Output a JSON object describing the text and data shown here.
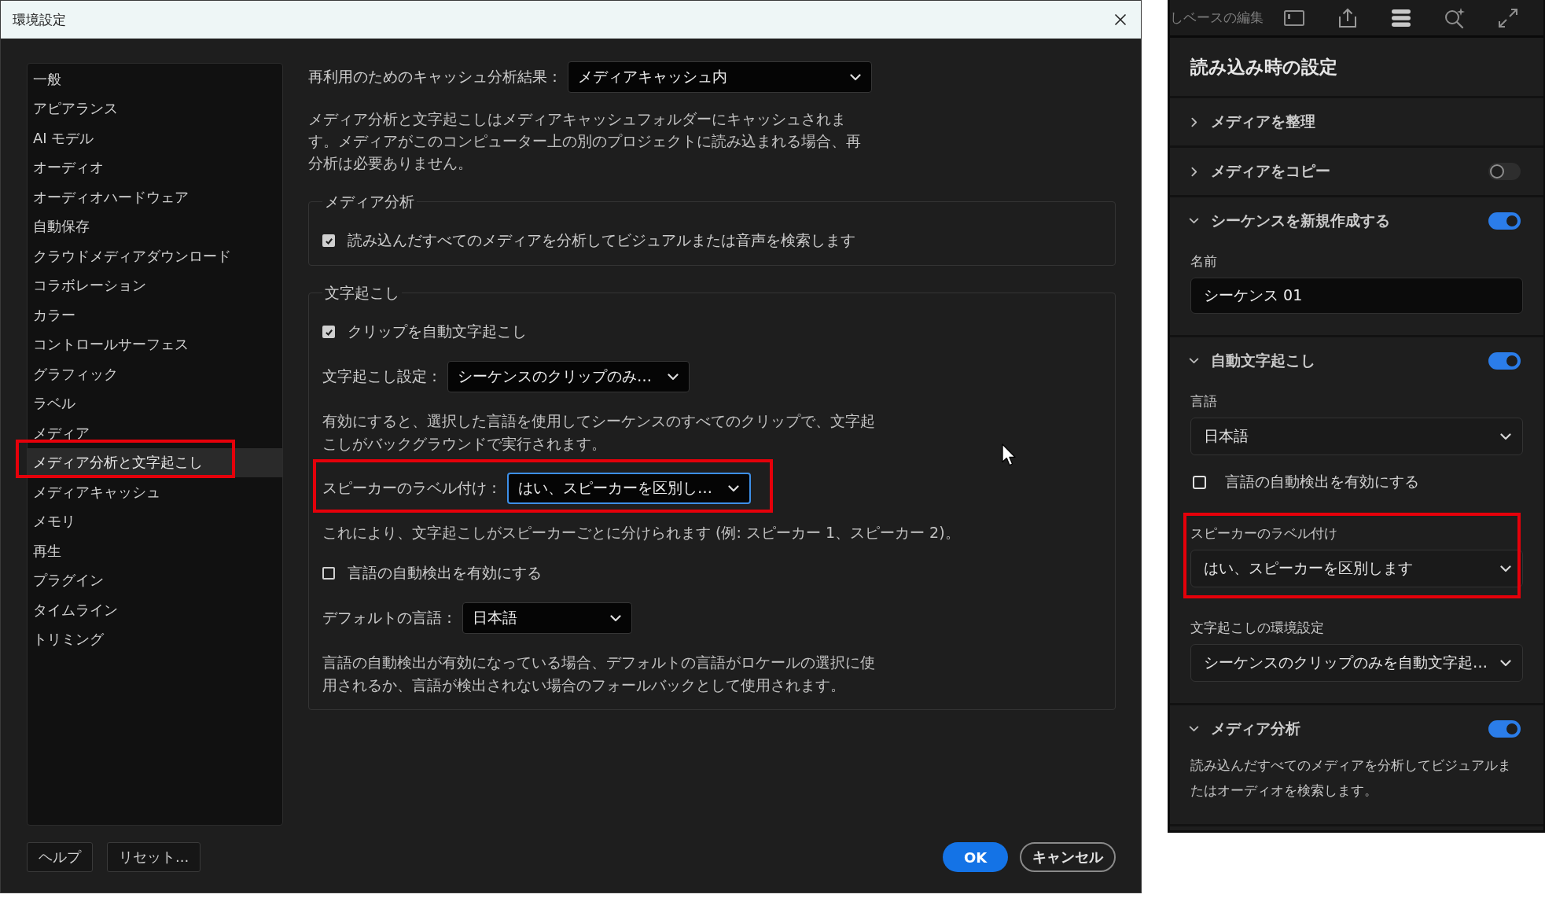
{
  "preferences_dialog": {
    "title": "環境設定",
    "sidebar": {
      "items": [
        {
          "label": "一般",
          "selected": false,
          "highlighted": false
        },
        {
          "label": "アピアランス",
          "selected": false,
          "highlighted": false
        },
        {
          "label": "AI モデル",
          "selected": false,
          "highlighted": false
        },
        {
          "label": "オーディオ",
          "selected": false,
          "highlighted": false
        },
        {
          "label": "オーディオハードウェア",
          "selected": false,
          "highlighted": false
        },
        {
          "label": "自動保存",
          "selected": false,
          "highlighted": false
        },
        {
          "label": "クラウドメディアダウンロード",
          "selected": false,
          "highlighted": false
        },
        {
          "label": "コラボレーション",
          "selected": false,
          "highlighted": false
        },
        {
          "label": "カラー",
          "selected": false,
          "highlighted": false
        },
        {
          "label": "コントロールサーフェス",
          "selected": false,
          "highlighted": false
        },
        {
          "label": "グラフィック",
          "selected": false,
          "highlighted": false
        },
        {
          "label": "ラベル",
          "selected": false,
          "highlighted": false
        },
        {
          "label": "メディア",
          "selected": false,
          "highlighted": false
        },
        {
          "label": "メディア分析と文字起こし",
          "selected": true,
          "highlighted": true
        },
        {
          "label": "メディアキャッシュ",
          "selected": false,
          "highlighted": false
        },
        {
          "label": "メモリ",
          "selected": false,
          "highlighted": false
        },
        {
          "label": "再生",
          "selected": false,
          "highlighted": false
        },
        {
          "label": "プラグイン",
          "selected": false,
          "highlighted": false
        },
        {
          "label": "タイムライン",
          "selected": false,
          "highlighted": false
        },
        {
          "label": "トリミング",
          "selected": false,
          "highlighted": false
        }
      ]
    },
    "cache_results": {
      "label": "再利用のためのキャッシュ分析結果：",
      "value": "メディアキャッシュ内"
    },
    "cache_description": "メディア分析と文字起こしはメディアキャッシュフォルダーにキャッシュされます。メディアがこのコンピューター上の別のプロジェクトに読み込まれる場合、再分析は必要ありません。",
    "groups": [
      {
        "title": "メディア分析",
        "rows": [
          {
            "kind": "checkbox",
            "label": "読み込んだすべてのメディアを分析してビジュアルまたは音声を検索します",
            "checked": true,
            "highlighted": false
          }
        ]
      },
      {
        "title": "文字起こし",
        "rows": [
          {
            "kind": "checkbox",
            "label": "クリップを自動文字起こし",
            "checked": true,
            "highlighted": false
          },
          {
            "kind": "dropdown",
            "label": "文字起こし設定：",
            "value": "シーケンスのクリップのみ…",
            "focused": false,
            "highlighted": false
          },
          {
            "kind": "description",
            "text": "有効にすると、選択した言語を使用してシーケンスのすべてのクリップで、文字起こしがバックグラウンドで実行されます。",
            "highlighted": false
          },
          {
            "kind": "dropdown",
            "label": "スピーカーのラベル付け：",
            "value": "はい、スピーカーを区別し…",
            "focused": true,
            "highlighted": true
          },
          {
            "kind": "note",
            "text": "これにより、文字起こしがスピーカーごとに分けられます (例: スピーカー 1、スピーカー 2)。",
            "highlighted": false
          },
          {
            "kind": "checkbox",
            "label": "言語の自動検出を有効にする",
            "checked": false,
            "highlighted": false
          },
          {
            "kind": "dropdown",
            "label": "デフォルトの言語：",
            "value": "日本語",
            "focused": false,
            "highlighted": false
          },
          {
            "kind": "description",
            "text": "言語の自動検出が有効になっている場合、デフォルトの言語がロケールの選択に使用されるか、言語が検出されない場合のフォールバックとして使用されます。",
            "highlighted": false
          }
        ]
      }
    ],
    "footer_buttons": [
      {
        "label": "ヘルプ",
        "kind": "secondary"
      },
      {
        "label": "リセット...",
        "kind": "secondary"
      },
      {
        "label": "OK",
        "kind": "primary"
      },
      {
        "label": "キャンセル",
        "kind": "outline"
      }
    ]
  },
  "import_settings_panel": {
    "toolbar_label": "しベースの編集",
    "title": "読み込み時の設定",
    "sections": [
      {
        "title": "メディアを整理",
        "expanded": false
      },
      {
        "title": "メディアをコピー",
        "expanded": false,
        "toggle": {
          "on": false
        }
      },
      {
        "title": "シーケンスを新規作成する",
        "expanded": true,
        "toggle": {
          "on": true
        },
        "fields": [
          {
            "kind": "text_input",
            "label": "名前",
            "value": "シーケンス 01",
            "highlighted": false
          }
        ]
      },
      {
        "title": "自動文字起こし",
        "expanded": true,
        "toggle": {
          "on": true
        },
        "fields": [
          {
            "kind": "dropdown",
            "label": "言語",
            "value": "日本語",
            "highlighted": false
          },
          {
            "kind": "checkbox",
            "label": "言語の自動検出を有効にする",
            "checked": false,
            "highlighted": false
          },
          {
            "kind": "dropdown",
            "label": "スピーカーのラベル付け",
            "value": "はい、スピーカーを区別します",
            "highlighted": true
          },
          {
            "kind": "dropdown",
            "label": "文字起こしの環境設定",
            "value": "シーケンスのクリップのみを自動文字起…",
            "highlighted": false
          }
        ]
      },
      {
        "title": "メディア分析",
        "expanded": true,
        "toggle": {
          "on": true
        },
        "fields": [
          {
            "kind": "text",
            "text": "読み込んだすべてのメディアを分析してビジュアルまたはオーディオを検索します。",
            "highlighted": false
          }
        ]
      }
    ]
  }
}
